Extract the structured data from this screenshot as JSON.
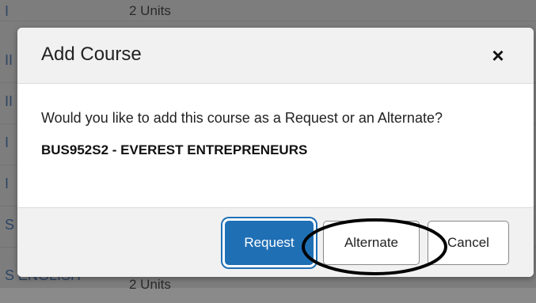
{
  "background": {
    "rows": [
      {
        "letter": "I",
        "units": "2 Units"
      },
      {
        "letter": "II",
        "units": ""
      },
      {
        "letter": "II",
        "units": ""
      },
      {
        "letter": "I",
        "units": ""
      },
      {
        "letter": "I",
        "units": ""
      },
      {
        "letter": "S",
        "units": ""
      },
      {
        "letter": "S ENGLISH",
        "units": "2 Units"
      }
    ]
  },
  "modal": {
    "title": "Add Course",
    "close_label": "×",
    "question": "Would you like to add this course as a Request or an Alternate?",
    "course": "BUS952S2 - EVEREST ENTREPRENEURS",
    "buttons": {
      "request": "Request",
      "alternate": "Alternate",
      "cancel": "Cancel"
    }
  },
  "colors": {
    "primary": "#1f6fb5",
    "header_bg": "#f1f1f1"
  }
}
